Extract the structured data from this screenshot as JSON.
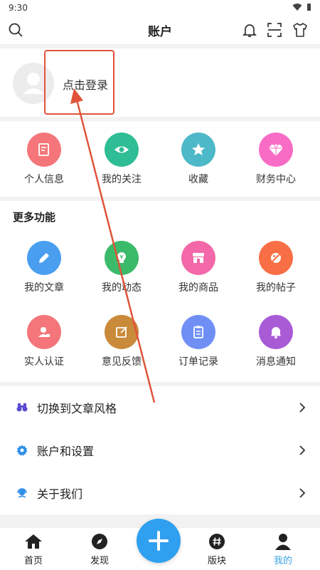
{
  "status_bar": {
    "time": "9:30"
  },
  "header": {
    "title": "账户"
  },
  "login": {
    "prompt": "点击登录"
  },
  "quick_links": [
    {
      "label": "个人信息",
      "color": "#f4767a",
      "icon": "edit-note-icon"
    },
    {
      "label": "我的关注",
      "color": "#2ebd94",
      "icon": "eye-icon"
    },
    {
      "label": "收藏",
      "color": "#4db8c8",
      "icon": "star-icon"
    },
    {
      "label": "财务中心",
      "color": "#f86cc6",
      "icon": "diamond-icon"
    }
  ],
  "more": {
    "title": "更多功能",
    "items": [
      {
        "label": "我的文章",
        "color": "#4a9ef0",
        "icon": "pencil-icon"
      },
      {
        "label": "我的动态",
        "color": "#3bba6a",
        "icon": "lightbulb-icon"
      },
      {
        "label": "我的商品",
        "color": "#f368a8",
        "icon": "store-icon"
      },
      {
        "label": "我的帖子",
        "color": "#f86f45",
        "icon": "slash-circle-icon"
      },
      {
        "label": "实人认证",
        "color": "#f4767a",
        "icon": "id-card-icon"
      },
      {
        "label": "意见反馈",
        "color": "#c98a3a",
        "icon": "feedback-icon"
      },
      {
        "label": "订单记录",
        "color": "#6f8ff5",
        "icon": "clipboard-icon"
      },
      {
        "label": "消息通知",
        "color": "#a95bd6",
        "icon": "bell-icon"
      }
    ]
  },
  "settings_list": [
    {
      "label": "切换到文章风格",
      "icon": "binoculars-icon",
      "color": "#5a4bd0"
    },
    {
      "label": "账户和设置",
      "icon": "gear-icon",
      "color": "#2f8fe8"
    },
    {
      "label": "关于我们",
      "icon": "support-icon",
      "color": "#2f8fe8"
    }
  ],
  "tabbar": {
    "items": [
      {
        "label": "首页",
        "icon": "home-icon"
      },
      {
        "label": "发现",
        "icon": "compass-icon"
      },
      {
        "label": "版块",
        "icon": "hashtag-icon"
      },
      {
        "label": "我的",
        "icon": "user-icon",
        "active": true
      }
    ],
    "fab_icon": "plus-icon",
    "accent": "#3aa3e3"
  },
  "annotation_color": "#e0533a"
}
